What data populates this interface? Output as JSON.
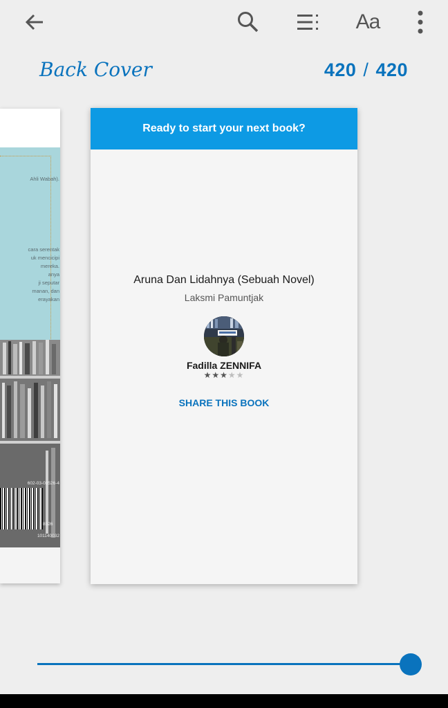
{
  "toolbar": {
    "back_icon": "arrow-left-icon",
    "search_icon": "search-icon",
    "toc_icon": "table-of-contents-icon",
    "text_settings_label": "Aa",
    "more_icon": "more-vertical-icon"
  },
  "header": {
    "section_title": "Back Cover",
    "current_page": "420",
    "page_separator": "/",
    "total_pages": "420"
  },
  "prev_page": {
    "lines_top": [
      "Ahli Wabah)."
    ],
    "lines_mid": [
      "cara serentak",
      "uk mencicipi",
      "mereka.",
      "anya",
      "ji seputar",
      "manan, dan",
      "erayakan"
    ],
    "isbn_top": "602-03-08526-4",
    "isbn_bottom": "101140032",
    "barcode_digits": "8526"
  },
  "end_card": {
    "banner": "Ready to start your next book?",
    "book_title": "Aruna Dan Lidahnya (Sebuah Novel)",
    "book_author": "Laksmi Pamuntjak",
    "reviewer_name": "Fadilla ZENNIFA",
    "rating": 3,
    "rating_max": 5,
    "share_label": "SHARE THIS BOOK"
  },
  "progress": {
    "position_fraction": 1.0
  },
  "colors": {
    "accent": "#0a73bd",
    "banner": "#0d9ae4",
    "background": "#eeeeee"
  }
}
